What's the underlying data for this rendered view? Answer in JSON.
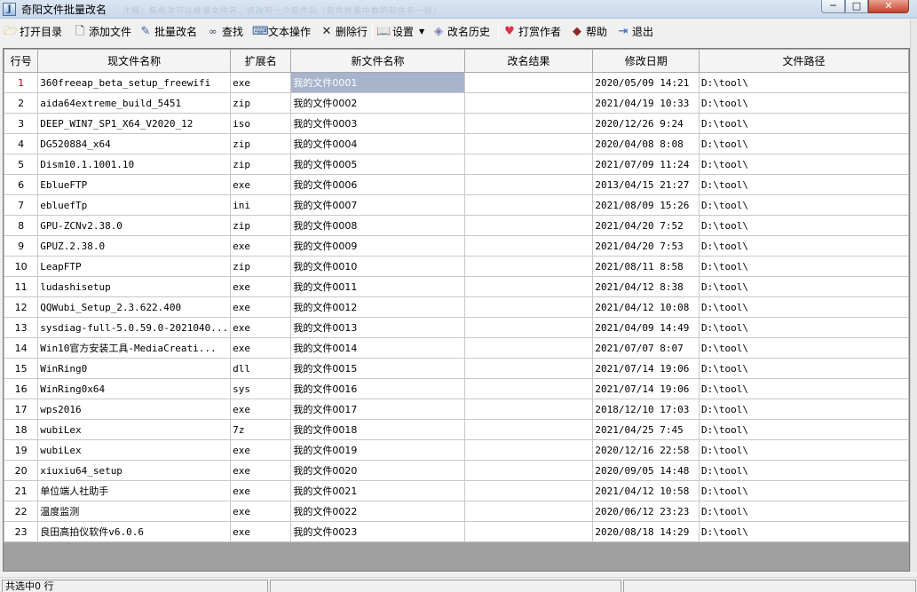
{
  "window": {
    "title": "奇阳文件批量改名",
    "title_extra": "注释：每批次可以批量文件名，修改前一个软件后（软件批量中数的软件名一段）",
    "controls": {
      "minimize": "─",
      "maximize": "□",
      "close": "✕"
    }
  },
  "toolbar": {
    "open_dir": "打开目录",
    "add_file": "添加文件",
    "batch_rename": "批量改名",
    "find": "查找",
    "text_ops": "文本操作",
    "delete_row": "删除行",
    "settings": "设置",
    "rename_history": "改名历史",
    "tip_author": "打赏作者",
    "help": "帮助",
    "exit": "退出"
  },
  "icons": {
    "open_dir": "folder-open-icon",
    "add_file": "document-icon",
    "batch_rename": "edit-icon",
    "find": "binoculars-icon",
    "text_ops": "keyboard-icon",
    "delete_row": "x-icon",
    "settings": "book-icon",
    "rename_history": "layers-icon",
    "tip_author": "heart-icon",
    "help": "help-book-icon",
    "exit": "exit-icon"
  },
  "colors": {
    "selected_cell": "#a8b3cc",
    "active_row_number": "#c00000",
    "tip_heart": "#e0304c"
  },
  "table": {
    "columns": [
      "行号",
      "现文件名称",
      "扩展名",
      "新文件名称",
      "改名结果",
      "修改日期",
      "文件路径"
    ],
    "rows": [
      {
        "n": "1",
        "name": "360freeap_beta_setup_freewifi",
        "ext": "exe",
        "new": "我的文件0001",
        "result": "",
        "date": "2020/05/09 14:21",
        "path": "D:\\tool\\"
      },
      {
        "n": "2",
        "name": "aida64extreme_build_5451",
        "ext": "zip",
        "new": "我的文件0002",
        "result": "",
        "date": "2021/04/19 10:33",
        "path": "D:\\tool\\"
      },
      {
        "n": "3",
        "name": "DEEP_WIN7_SP1_X64_V2020_12",
        "ext": "iso",
        "new": "我的文件0003",
        "result": "",
        "date": "2020/12/26 9:24",
        "path": "D:\\tool\\"
      },
      {
        "n": "4",
        "name": "DG520884_x64",
        "ext": "zip",
        "new": "我的文件0004",
        "result": "",
        "date": "2020/04/08 8:08",
        "path": "D:\\tool\\"
      },
      {
        "n": "5",
        "name": "Dism10.1.1001.10",
        "ext": "zip",
        "new": "我的文件0005",
        "result": "",
        "date": "2021/07/09 11:24",
        "path": "D:\\tool\\"
      },
      {
        "n": "6",
        "name": "EblueFTP",
        "ext": "exe",
        "new": "我的文件0006",
        "result": "",
        "date": "2013/04/15 21:27",
        "path": "D:\\tool\\"
      },
      {
        "n": "7",
        "name": "ebluefTp",
        "ext": "ini",
        "new": "我的文件0007",
        "result": "",
        "date": "2021/08/09 15:26",
        "path": "D:\\tool\\"
      },
      {
        "n": "8",
        "name": "GPU-ZCNv2.38.0",
        "ext": "zip",
        "new": "我的文件0008",
        "result": "",
        "date": "2021/04/20 7:52",
        "path": "D:\\tool\\"
      },
      {
        "n": "9",
        "name": "GPUZ.2.38.0",
        "ext": "exe",
        "new": "我的文件0009",
        "result": "",
        "date": "2021/04/20 7:53",
        "path": "D:\\tool\\"
      },
      {
        "n": "10",
        "name": "LeapFTP",
        "ext": "zip",
        "new": "我的文件0010",
        "result": "",
        "date": "2021/08/11 8:58",
        "path": "D:\\tool\\"
      },
      {
        "n": "11",
        "name": "ludashisetup",
        "ext": "exe",
        "new": "我的文件0011",
        "result": "",
        "date": "2021/04/12 8:38",
        "path": "D:\\tool\\"
      },
      {
        "n": "12",
        "name": "QQWubi_Setup_2.3.622.400",
        "ext": "exe",
        "new": "我的文件0012",
        "result": "",
        "date": "2021/04/12 10:08",
        "path": "D:\\tool\\"
      },
      {
        "n": "13",
        "name": "sysdiag-full-5.0.59.0-2021040...",
        "ext": "exe",
        "new": "我的文件0013",
        "result": "",
        "date": "2021/04/09 14:49",
        "path": "D:\\tool\\"
      },
      {
        "n": "14",
        "name": "Win10官方安装工具-MediaCreati...",
        "ext": "exe",
        "new": "我的文件0014",
        "result": "",
        "date": "2021/07/07 8:07",
        "path": "D:\\tool\\"
      },
      {
        "n": "15",
        "name": "WinRing0",
        "ext": "dll",
        "new": "我的文件0015",
        "result": "",
        "date": "2021/07/14 19:06",
        "path": "D:\\tool\\"
      },
      {
        "n": "16",
        "name": "WinRing0x64",
        "ext": "sys",
        "new": "我的文件0016",
        "result": "",
        "date": "2021/07/14 19:06",
        "path": "D:\\tool\\"
      },
      {
        "n": "17",
        "name": "wps2016",
        "ext": "exe",
        "new": "我的文件0017",
        "result": "",
        "date": "2018/12/10 17:03",
        "path": "D:\\tool\\"
      },
      {
        "n": "18",
        "name": "wubiLex",
        "ext": "7z",
        "new": "我的文件0018",
        "result": "",
        "date": "2021/04/25 7:45",
        "path": "D:\\tool\\"
      },
      {
        "n": "19",
        "name": "wubiLex",
        "ext": "exe",
        "new": "我的文件0019",
        "result": "",
        "date": "2020/12/16 22:58",
        "path": "D:\\tool\\"
      },
      {
        "n": "20",
        "name": "xiuxiu64_setup",
        "ext": "exe",
        "new": "我的文件0020",
        "result": "",
        "date": "2020/09/05 14:48",
        "path": "D:\\tool\\"
      },
      {
        "n": "21",
        "name": "单位端人社助手",
        "ext": "exe",
        "new": "我的文件0021",
        "result": "",
        "date": "2021/04/12 10:58",
        "path": "D:\\tool\\"
      },
      {
        "n": "22",
        "name": "温度监测",
        "ext": "exe",
        "new": "我的文件0022",
        "result": "",
        "date": "2020/06/12 23:23",
        "path": "D:\\tool\\"
      },
      {
        "n": "23",
        "name": "良田高拍仪软件v6.0.6",
        "ext": "exe",
        "new": "我的文件0023",
        "result": "",
        "date": "2020/08/18 14:29",
        "path": "D:\\tool\\"
      }
    ]
  },
  "status": {
    "selected": "共选中0 行",
    "panel2": "",
    "panel3": ""
  }
}
